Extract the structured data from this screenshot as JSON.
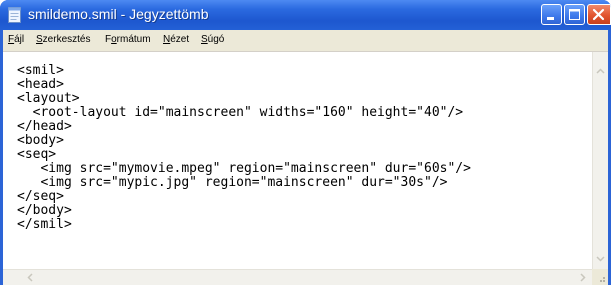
{
  "window": {
    "title": "smildemo.smil - Jegyzettömb",
    "icons": {
      "app": "notepad-icon",
      "minimize": "minimize-icon",
      "maximize": "maximize-icon",
      "close": "close-icon"
    },
    "colors": {
      "titlebar": "#2b6ae0",
      "close_button": "#e2542e"
    }
  },
  "menu": {
    "items": [
      {
        "label_accel": "F",
        "label_rest": "ájl"
      },
      {
        "label_accel": "S",
        "label_rest": "zerkesztés"
      },
      {
        "label_pre": "F",
        "label_accel": "o",
        "label_rest": "rmátum"
      },
      {
        "label_accel": "N",
        "label_rest": "ézet"
      },
      {
        "label_accel": "S",
        "label_rest": "úgó"
      }
    ]
  },
  "editor": {
    "lines": [
      "<smil>",
      "<head>",
      "<layout>",
      "  <root-layout id=\"mainscreen\" widths=\"160\" height=\"40\"/>",
      "</head>",
      "<body>",
      "<seq>",
      "   <img src=\"mymovie.mpeg\" region=\"mainscreen\" dur=\"60s\"/>",
      "   <img src=\"mypic.jpg\" region=\"mainscreen\" dur=\"30s\"/>",
      "</seq>",
      "</body>",
      "</smil>"
    ]
  },
  "scrollbars": {
    "icons": {
      "up": "scroll-up-icon",
      "down": "scroll-down-icon",
      "left": "scroll-left-icon",
      "right": "scroll-right-icon"
    }
  }
}
